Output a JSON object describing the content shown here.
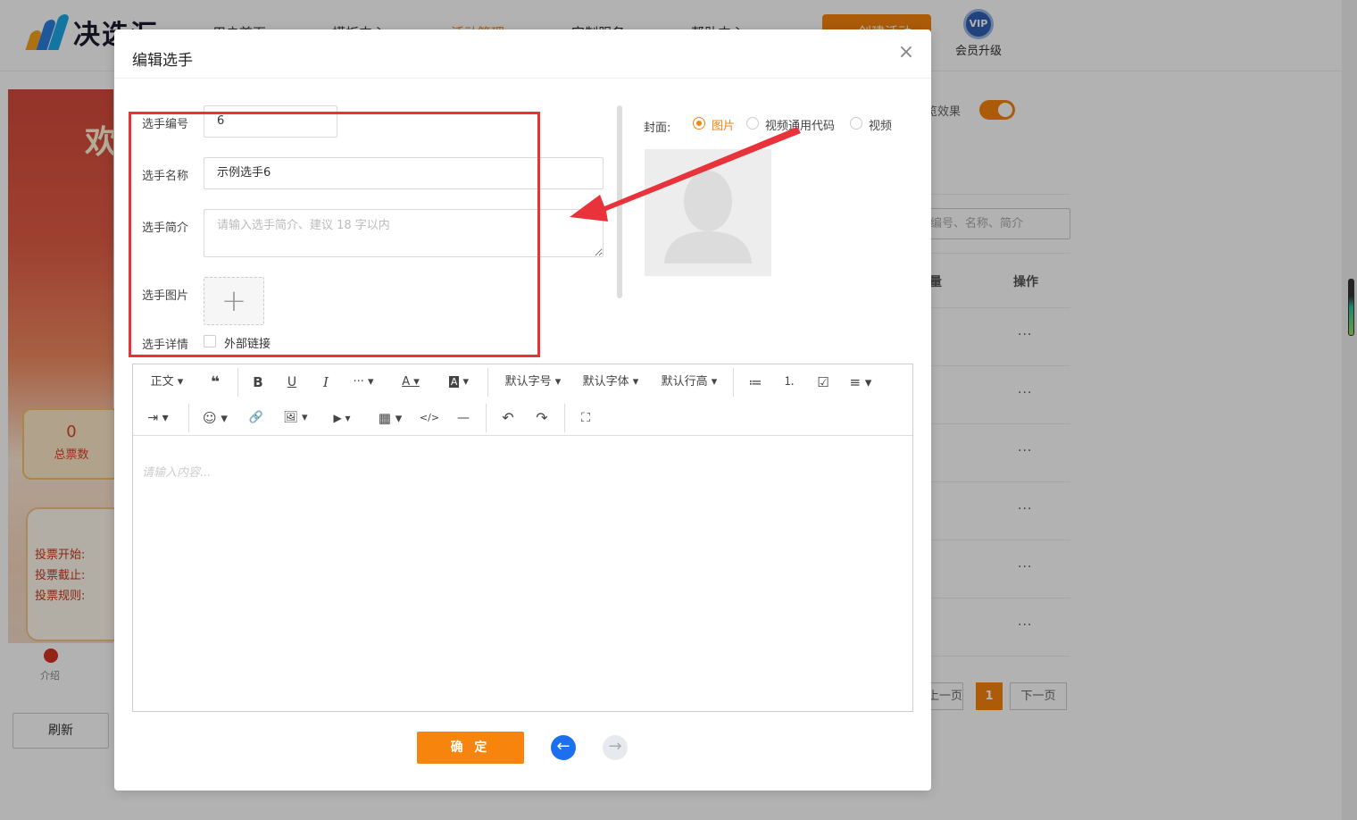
{
  "background": {
    "brand": "决选汇",
    "nav": [
      "用户首页",
      "模板中心",
      "活动管理",
      "定制服务",
      "帮助中心"
    ],
    "create_button": "创建活动",
    "vip_badge": "VIP",
    "vip_label": "会员升级",
    "poster": {
      "welcome": "欢",
      "total_votes": "0",
      "total_votes_label": "总票数",
      "vote_start": "投票开始:",
      "vote_end": "投票截止:",
      "vote_rules": "投票规则:",
      "tab_intro": "介绍"
    },
    "refresh_button": "刷新",
    "preview_label": "览效果",
    "search_placeholder": "编号、名称、简介",
    "table_headers": [
      "量",
      "操作"
    ],
    "row_action": "···",
    "pagination": {
      "prev": "上一页",
      "current": "1",
      "next": "下一页"
    }
  },
  "modal": {
    "title": "编辑选手",
    "fields": {
      "number_label": "选手编号",
      "number_value": "6",
      "name_label": "选手名称",
      "name_value": "示例选手6",
      "intro_label": "选手简介",
      "intro_placeholder": "请输入选手简介、建议 18 字以内",
      "image_label": "选手图片",
      "detail_label": "选手详情",
      "external_link_label": "外部链接"
    },
    "cover": {
      "label": "封面:",
      "options": [
        "图片",
        "视频通用代码",
        "视频"
      ],
      "selected": "图片"
    },
    "editor": {
      "toolbar_row1": [
        "正文",
        "❝",
        "B",
        "U",
        "I",
        "···",
        "A",
        "A",
        "默认字号",
        "默认字体",
        "默认行高",
        "≔",
        "⒈",
        "☑",
        "≡"
      ],
      "toolbar_row2": [
        "⇥",
        "☺",
        "🔗",
        "🖼",
        "▶",
        "▦",
        "</>",
        "—",
        "↶",
        "↷",
        "⛶"
      ],
      "placeholder": "请输入内容..."
    },
    "confirm_button": "确 定",
    "prev_icon": "←",
    "next_icon": "→",
    "close_icon": "×"
  },
  "colors": {
    "accent": "#f7840c",
    "annotation_red": "#e8333a",
    "nav_blue": "#1e6ff0"
  }
}
